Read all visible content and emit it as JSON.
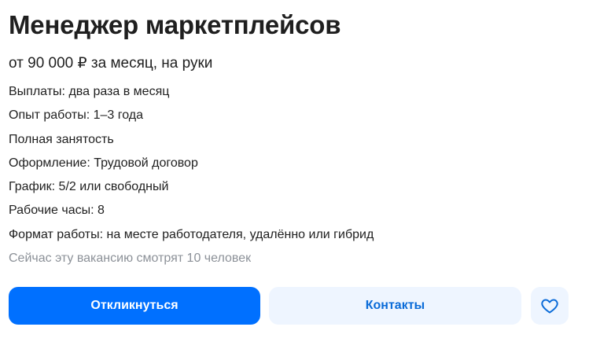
{
  "vacancy": {
    "title": "Менеджер маркетплейсов",
    "salary": "от 90 000 ₽ за месяц, на руки",
    "facts": [
      "Выплаты: два раза в месяц",
      "Опыт работы: 1–3 года",
      "Полная занятость",
      "Оформление: Трудовой договор",
      "График: 5/2 или свободный",
      "Рабочие часы: 8",
      "Формат работы: на месте работодателя, удалённо или гибрид"
    ],
    "viewers_note": "Сейчас эту вакансию смотрят 10 человек"
  },
  "actions": {
    "apply_label": "Откликнуться",
    "contacts_label": "Контакты",
    "favorite_icon": "heart-icon"
  },
  "colors": {
    "primary": "#0070ff",
    "secondary_bg": "#eef5ff",
    "secondary_text": "#0a6bd8",
    "muted_text": "#8c9198"
  }
}
